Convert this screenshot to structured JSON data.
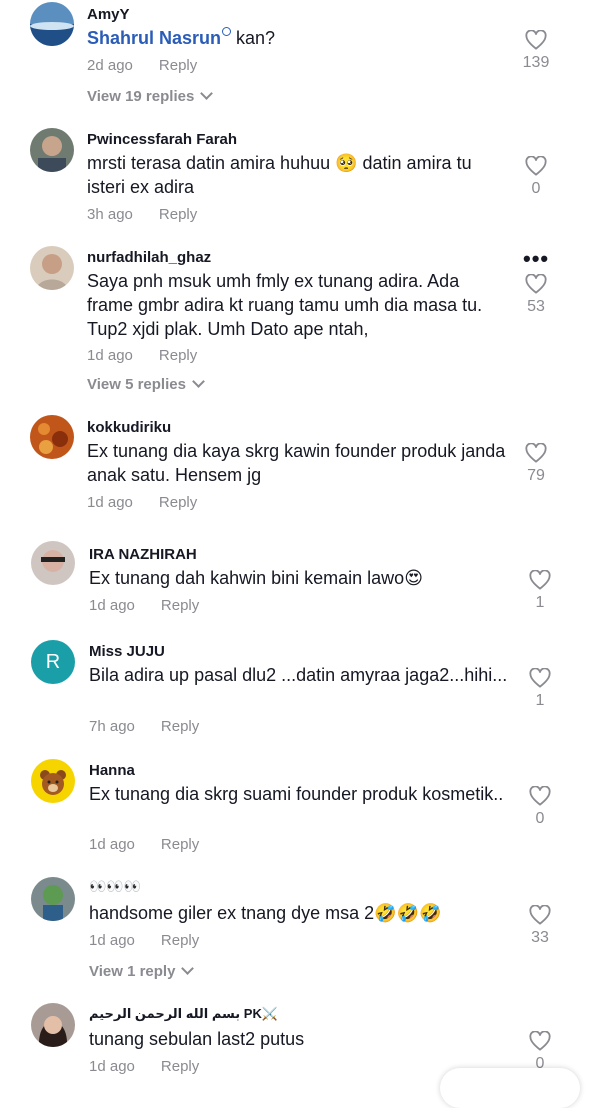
{
  "comments": [
    {
      "user": "AmyY",
      "mention": "Shahrul Nasrun",
      "text": " kan?",
      "time": "2d ago",
      "reply": "Reply",
      "likes": "139",
      "view_replies": "View 19 replies"
    },
    {
      "user": "Pwincessfarah Farah",
      "text": "mrsti terasa datin amira huhuu 🥺 datin amira tu isteri ex adira",
      "time": "3h ago",
      "reply": "Reply",
      "likes": "0"
    },
    {
      "user": "nurfadhilah_ghaz",
      "text": "Saya pnh msuk umh fmly ex tunang adira. Ada frame gmbr adira kt ruang tamu umh dia masa tu. Tup2 xjdi plak. Umh Dato ape ntah,",
      "time": "1d ago",
      "reply": "Reply",
      "likes": "53",
      "view_replies": "View 5 replies"
    },
    {
      "user": "kokkudiriku",
      "text": "Ex tunang dia kaya skrg kawin founder produk janda anak satu. Hensem jg",
      "time": "1d ago",
      "reply": "Reply",
      "likes": "79"
    },
    {
      "user": "IRA NAZHIRAH",
      "text": "Ex tunang dah kahwin bini kemain lawo😍",
      "time": "1d ago",
      "reply": "Reply",
      "likes": "1"
    },
    {
      "user": "Miss JUJU",
      "avatar_letter": "R",
      "text": "Bila adira up pasal dlu2 ...datin amyraa jaga2...hihi...",
      "time": "7h ago",
      "reply": "Reply",
      "likes": "1"
    },
    {
      "user": "Hanna",
      "text": "Ex tunang dia skrg suami founder produk kosmetik..",
      "time": "1d ago",
      "reply": "Reply",
      "likes": "0"
    },
    {
      "user": "👀👀👀",
      "text": "handsome giler ex tnang dye msa 2🤣🤣🤣",
      "time": "1d ago",
      "reply": "Reply",
      "likes": "33",
      "view_replies": "View 1 reply"
    },
    {
      "user": "بسم الله الرحمن الرحيم PK⚔️",
      "text": "tunang sebulan last2 putus",
      "time": "1d ago",
      "reply": "Reply",
      "likes": "0"
    }
  ],
  "colors": {
    "mention": "#2b5db8",
    "meta": "#8a8b91",
    "avatar_r": "#1a9fa8"
  },
  "icons": {
    "like": "heart-outline-icon",
    "more": "more-horizontal-icon",
    "mention_search": "search-icon"
  }
}
